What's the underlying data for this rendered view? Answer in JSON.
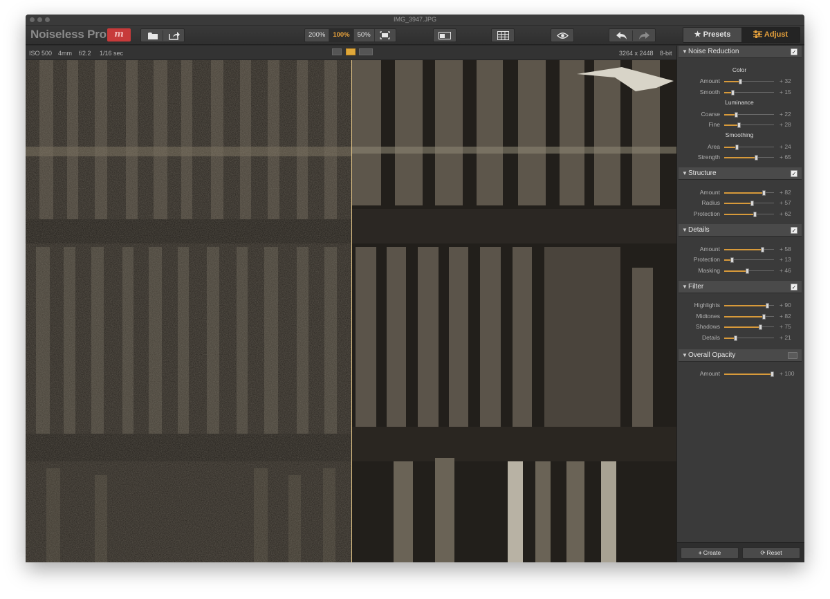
{
  "window": {
    "title": "IMG_3947.JPG"
  },
  "app": {
    "name": "Noiseless Pro",
    "logo_letter": "m"
  },
  "toolbar": {
    "zoom": [
      {
        "label": "200%",
        "active": false
      },
      {
        "label": "100%",
        "active": true
      },
      {
        "label": "50%",
        "active": false
      }
    ],
    "tabs": {
      "presets": "★ Presets",
      "adjust": "Adjust"
    }
  },
  "infobar": {
    "iso": "ISO 500",
    "focal": "4mm",
    "aperture": "f/2.2",
    "shutter": "1/16 sec",
    "dimensions": "3264 x 2448",
    "bitdepth": "8-bit"
  },
  "panel": {
    "noise_reduction": {
      "title": "Noise Reduction",
      "checked": true,
      "color_label": "Color",
      "color": [
        {
          "label": "Amount",
          "value": "+ 32",
          "pos": 32
        },
        {
          "label": "Smooth",
          "value": "+ 15",
          "pos": 15
        }
      ],
      "luminance_label": "Luminance",
      "luminance": [
        {
          "label": "Coarse",
          "value": "+ 22",
          "pos": 22
        },
        {
          "label": "Fine",
          "value": "+ 28",
          "pos": 28
        }
      ],
      "smoothing_label": "Smoothing",
      "smoothing": [
        {
          "label": "Area",
          "value": "+ 24",
          "pos": 24
        },
        {
          "label": "Strength",
          "value": "+ 65",
          "pos": 65
        }
      ]
    },
    "structure": {
      "title": "Structure",
      "checked": true,
      "sliders": [
        {
          "label": "Amount",
          "value": "+ 82",
          "pos": 82
        },
        {
          "label": "Radius",
          "value": "+ 57",
          "pos": 57
        },
        {
          "label": "Protection",
          "value": "+ 62",
          "pos": 62
        }
      ]
    },
    "details": {
      "title": "Details",
      "checked": true,
      "sliders": [
        {
          "label": "Amount",
          "value": "+ 58",
          "pos": 79
        },
        {
          "label": "Protection",
          "value": "+ 13",
          "pos": 13
        },
        {
          "label": "Masking",
          "value": "+ 46",
          "pos": 46
        }
      ]
    },
    "filter": {
      "title": "Filter",
      "checked": true,
      "sliders": [
        {
          "label": "Highlights",
          "value": "+ 90",
          "pos": 90
        },
        {
          "label": "Midtones",
          "value": "+ 82",
          "pos": 82
        },
        {
          "label": "Shadows",
          "value": "+ 75",
          "pos": 75
        },
        {
          "label": "Details",
          "value": "+ 21",
          "pos": 21
        }
      ]
    },
    "opacity": {
      "title": "Overall Opacity",
      "checked": false,
      "sliders": [
        {
          "label": "Amount",
          "value": "+ 100",
          "pos": 100
        }
      ]
    },
    "footer": {
      "create": "Create",
      "reset": "Reset"
    }
  },
  "colors": {
    "accent": "#e8a23c",
    "slider_fill": "#d89a3a"
  }
}
